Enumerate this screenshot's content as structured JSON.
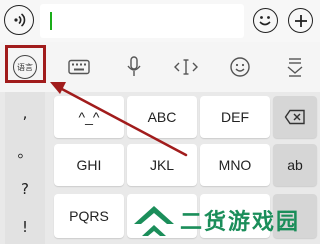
{
  "input_bar": {
    "text_value": "",
    "icons": {
      "voice_toggle": "voice-mode-icon",
      "emoji": "emoji-icon",
      "more": "plus-icon"
    }
  },
  "toolbar": {
    "items": [
      {
        "icon": "language-switch-icon",
        "label": "语言"
      },
      {
        "icon": "keyboard-icon"
      },
      {
        "icon": "microphone-icon"
      },
      {
        "icon": "cursor-move-icon"
      },
      {
        "icon": "emoji-icon"
      },
      {
        "icon": "hide-keyboard-icon"
      }
    ]
  },
  "keyboard": {
    "punctuation": [
      ",",
      "。",
      "?",
      "!"
    ],
    "rows": [
      [
        "^_^",
        "ABC",
        "DEF",
        "⌫"
      ],
      [
        "GHI",
        "JKL",
        "MNO",
        "ab"
      ],
      [
        "PQRS",
        "",
        "",
        ""
      ]
    ]
  },
  "annotation": {
    "color": "#a11c1c",
    "target": "language-switch-button"
  },
  "watermark": {
    "text": "二货游戏园",
    "color": "#1b8e5a"
  }
}
